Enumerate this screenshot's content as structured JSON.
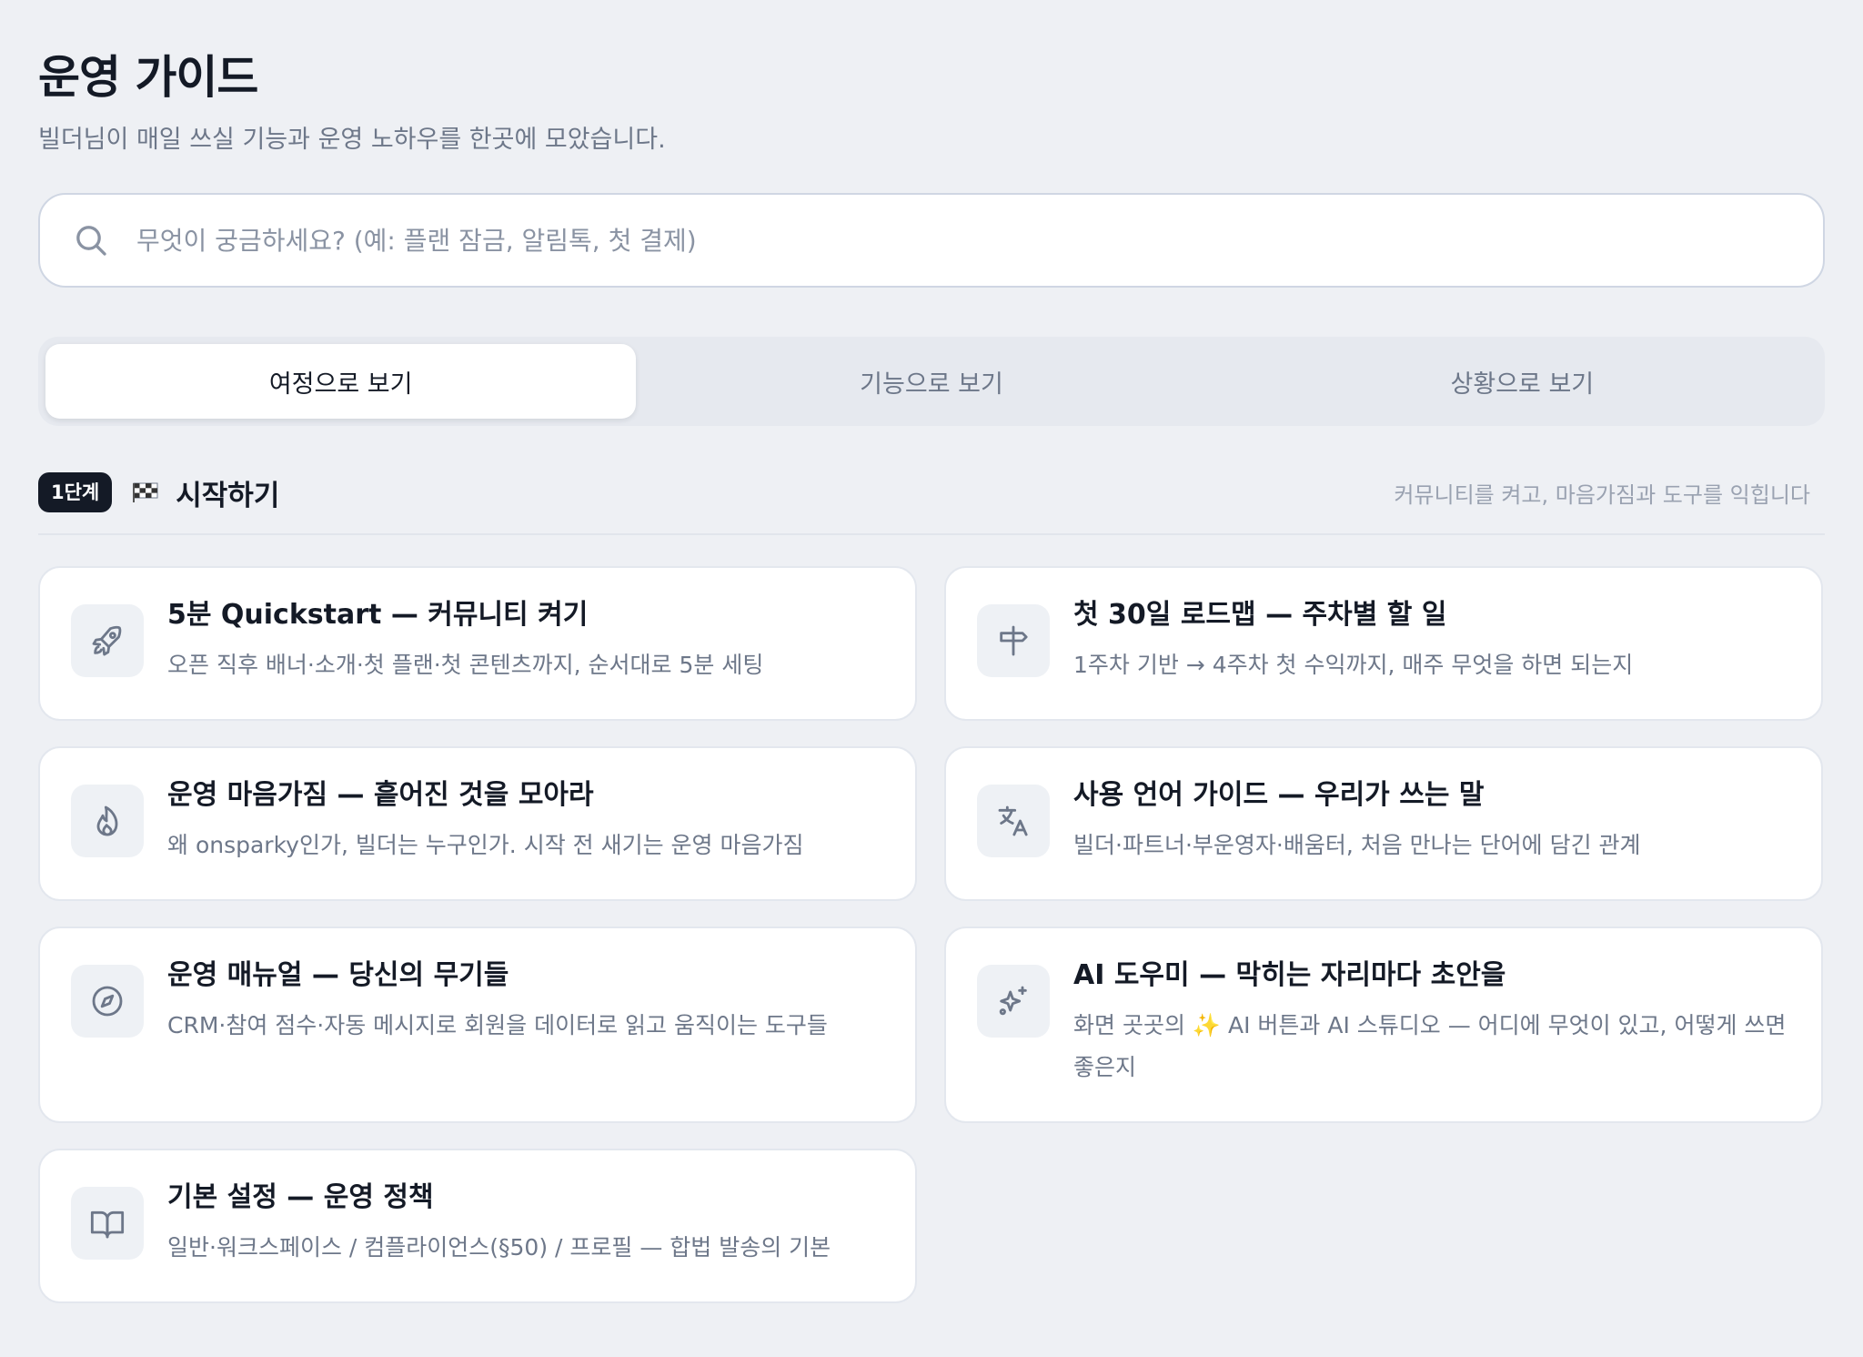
{
  "header": {
    "title": "운영 가이드",
    "subtitle": "빌더님이 매일 쓰실 기능과 운영 노하우를 한곳에 모았습니다."
  },
  "search": {
    "placeholder": "무엇이 궁금하세요? (예: 플랜 잠금, 알림톡, 첫 결제)",
    "value": ""
  },
  "tabs": [
    {
      "label": "여정으로 보기",
      "active": true
    },
    {
      "label": "기능으로 보기",
      "active": false
    },
    {
      "label": "상황으로 보기",
      "active": false
    }
  ],
  "stage": {
    "badge": "1단계",
    "icon": "checkered-flag-icon",
    "title": "시작하기",
    "description": "커뮤니티를 켜고, 마음가짐과 도구를 익힙니다"
  },
  "cards": [
    {
      "icon": "rocket-icon",
      "title": "5분 Quickstart — 커뮤니티 켜기",
      "description": "오픈 직후 배너·소개·첫 플랜·첫 콘텐츠까지, 순서대로 5분 세팅"
    },
    {
      "icon": "signpost-icon",
      "title": "첫 30일 로드맵 — 주차별 할 일",
      "description": "1주차 기반 → 4주차 첫 수익까지, 매주 무엇을 하면 되는지"
    },
    {
      "icon": "flame-icon",
      "title": "운영 마음가짐 — 흩어진 것을 모아라",
      "description": "왜 onsparky인가, 빌더는 누구인가. 시작 전 새기는 운영 마음가짐"
    },
    {
      "icon": "translate-icon",
      "title": "사용 언어 가이드 — 우리가 쓰는 말",
      "description": "빌더·파트너·부운영자·배움터, 처음 만나는 단어에 담긴 관계"
    },
    {
      "icon": "compass-icon",
      "title": "운영 매뉴얼 — 당신의 무기들",
      "description": "CRM·참여 점수·자동 메시지로 회원을 데이터로 읽고 움직이는 도구들"
    },
    {
      "icon": "sparkles-icon",
      "title": "AI 도우미 — 막히는 자리마다 초안을",
      "description": "화면 곳곳의 ✨  AI 버튼과 AI 스튜디오 — 어디에 무엇이 있고, 어떻게 쓰면 좋은지"
    },
    {
      "icon": "book-open-icon",
      "title": "기본 설정 — 운영 정책",
      "description": "일반·워크스페이스 / 컴플라이언스(§50) / 프로필 — 합법 발송의 기본"
    }
  ]
}
